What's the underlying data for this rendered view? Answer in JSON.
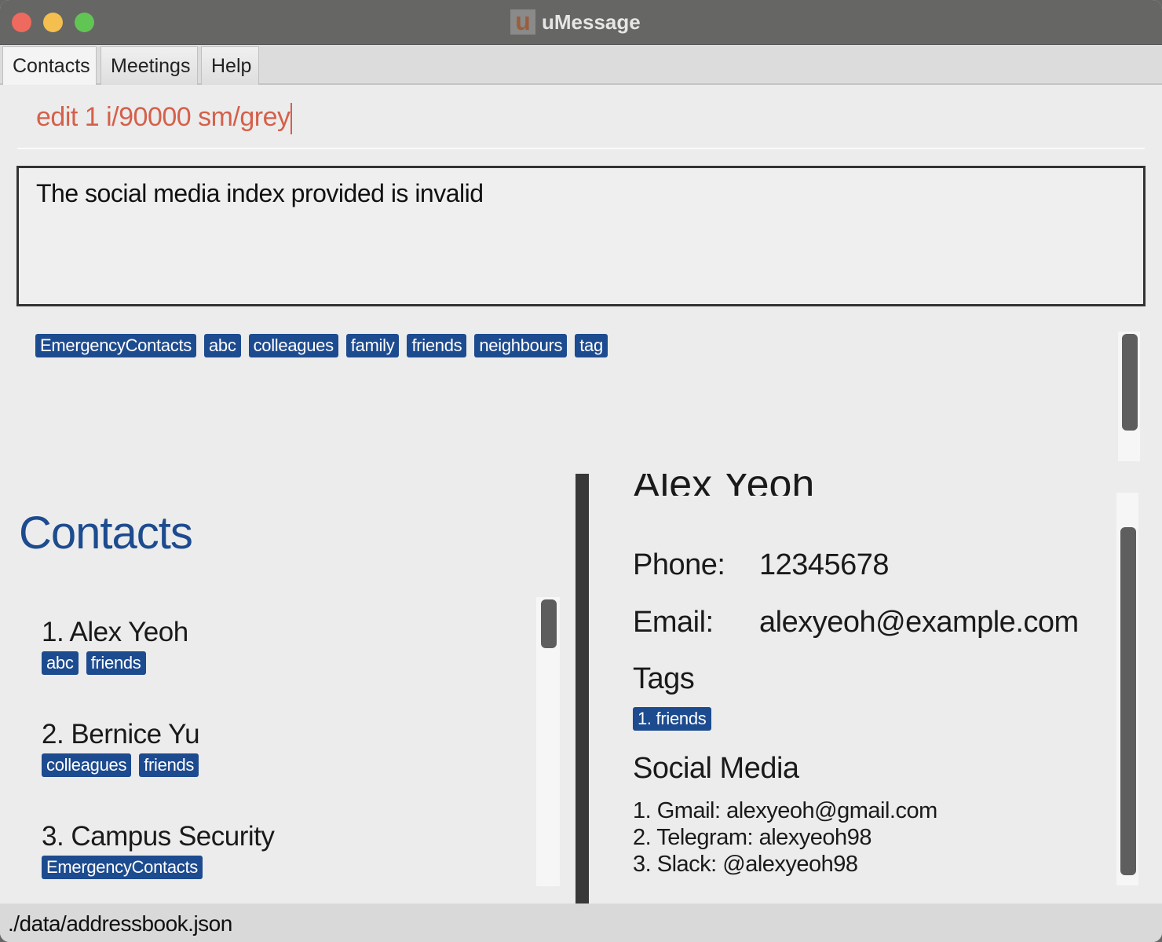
{
  "window": {
    "title": "uMessage",
    "logo_letter": "U"
  },
  "tabs": [
    {
      "label": "Contacts",
      "active": true
    },
    {
      "label": "Meetings"
    },
    {
      "label": "Help"
    }
  ],
  "command": {
    "value": "edit 1 i/90000 sm/grey",
    "color": "#d5604a"
  },
  "result": {
    "text": "The social media index provided is invalid"
  },
  "all_tags": [
    "EmergencyContacts",
    "abc",
    "colleagues",
    "family",
    "friends",
    "neighbours",
    "tag"
  ],
  "contacts": {
    "heading": "Contacts",
    "list": [
      {
        "label": "1.  Alex Yeoh",
        "tags": [
          "abc",
          "friends"
        ]
      },
      {
        "label": "2.  Bernice Yu",
        "tags": [
          "colleagues",
          "friends"
        ]
      },
      {
        "label": "3.  Campus Security",
        "tags": [
          "EmergencyContacts"
        ]
      }
    ]
  },
  "detail": {
    "name": "Alex Yeoh",
    "phone_label": "Phone:",
    "phone": "12345678",
    "email_label": "Email:",
    "email": "alexyeoh@example.com",
    "tags_heading": "Tags",
    "tags": [
      "1. friends"
    ],
    "social_heading": "Social Media",
    "social": [
      "1. Gmail: alexyeoh@gmail.com",
      "2. Telegram: alexyeoh98",
      "3. Slack: @alexyeoh98"
    ]
  },
  "status": {
    "path": "./data/addressbook.json"
  },
  "colors": {
    "accent": "#1d4b8f",
    "tag_bg": "#1d4b8f",
    "error_text": "#d5604a"
  }
}
